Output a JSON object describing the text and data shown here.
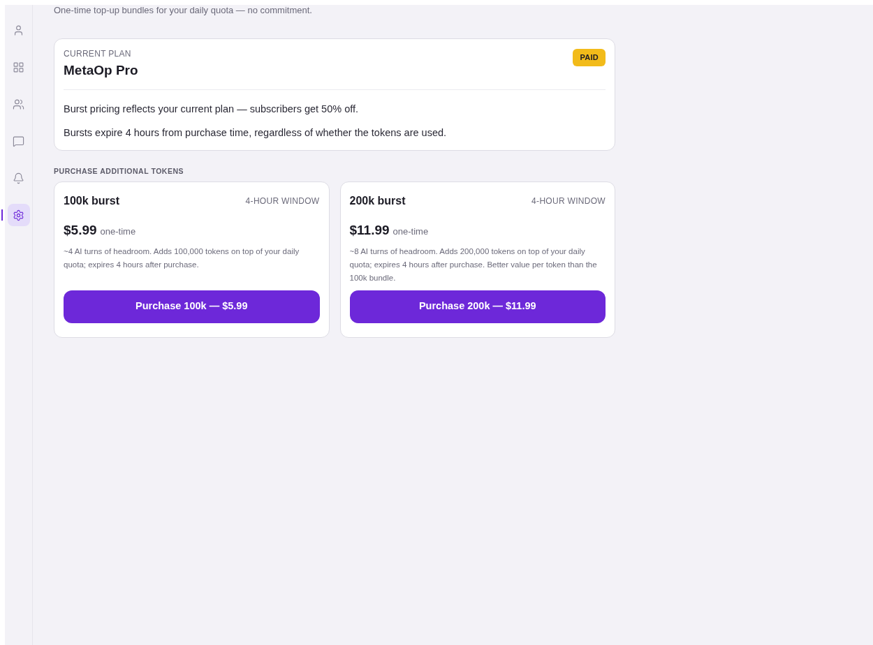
{
  "subtitle": "One-time top-up bundles for your daily quota — no commitment.",
  "sidebar": {
    "items": [
      {
        "kind": "user",
        "selected": false
      },
      {
        "kind": "grid",
        "selected": false
      },
      {
        "kind": "users",
        "selected": false
      },
      {
        "kind": "message",
        "selected": false
      },
      {
        "kind": "bell",
        "selected": false
      },
      {
        "kind": "settings",
        "selected": true
      }
    ]
  },
  "current_plan": {
    "label": "CURRENT PLAN",
    "name": "MetaOp Pro",
    "badge": "PAID",
    "notes": [
      "Burst pricing reflects your current plan — subscribers get 50% off.",
      "Bursts expire 4 hours from purchase time, regardless of whether the tokens are used."
    ]
  },
  "section_title": "PURCHASE ADDITIONAL TOKENS",
  "bundles": [
    {
      "title": "100k burst",
      "window": "4-HOUR WINDOW",
      "price": "$5.99",
      "price_note": "one-time",
      "description": "~4 AI turns of headroom. Adds 100,000 tokens on top of your daily quota; expires 4 hours after purchase.",
      "button": "Purchase 100k — $5.99"
    },
    {
      "title": "200k burst",
      "window": "4-HOUR WINDOW",
      "price": "$11.99",
      "price_note": "one-time",
      "description": "~8 AI turns of headroom. Adds 200,000 tokens on top of your daily quota; expires 4 hours after purchase. Better value per token than the 100k bundle.",
      "button": "Purchase 200k — $11.99"
    }
  ]
}
